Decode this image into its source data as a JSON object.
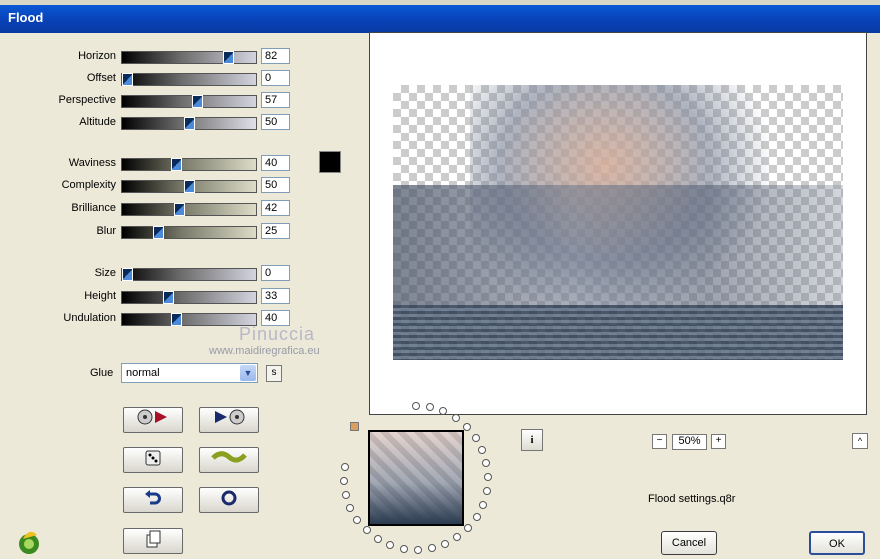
{
  "window": {
    "title": "Flood"
  },
  "params": [
    {
      "label": "Horizon",
      "value": "82",
      "fraction": 0.82
    },
    {
      "label": "Offset",
      "value": "0",
      "fraction": 0.0
    },
    {
      "label": "Perspective",
      "value": "57",
      "fraction": 0.57
    },
    {
      "label": "Altitude",
      "value": "50",
      "fraction": 0.5
    },
    {
      "label": "Waviness",
      "value": "40",
      "fraction": 0.4
    },
    {
      "label": "Complexity",
      "value": "50",
      "fraction": 0.5
    },
    {
      "label": "Brilliance",
      "value": "42",
      "fraction": 0.42
    },
    {
      "label": "Blur",
      "value": "25",
      "fraction": 0.25
    },
    {
      "label": "Size",
      "value": "0",
      "fraction": 0.0
    },
    {
      "label": "Height",
      "value": "33",
      "fraction": 0.33
    },
    {
      "label": "Undulation",
      "value": "40",
      "fraction": 0.4
    }
  ],
  "color_swatch": "#000000",
  "glue": {
    "label": "Glue",
    "value": "normal",
    "button": "s"
  },
  "watermark": {
    "name": "Pinuccia",
    "url": "www.maidiregrafica.eu"
  },
  "tool_buttons": [
    "play-settings-icon",
    "settings-play-icon",
    "dice-icon",
    "wave-icon",
    "undo-icon",
    "reset-icon",
    "copy-icon"
  ],
  "info_button": "i",
  "zoom": {
    "minus": "−",
    "value": "50%",
    "plus": "+"
  },
  "up_button": "^",
  "settings_file": "Flood settings.q8r",
  "buttons": {
    "cancel": "Cancel",
    "ok": "OK"
  }
}
